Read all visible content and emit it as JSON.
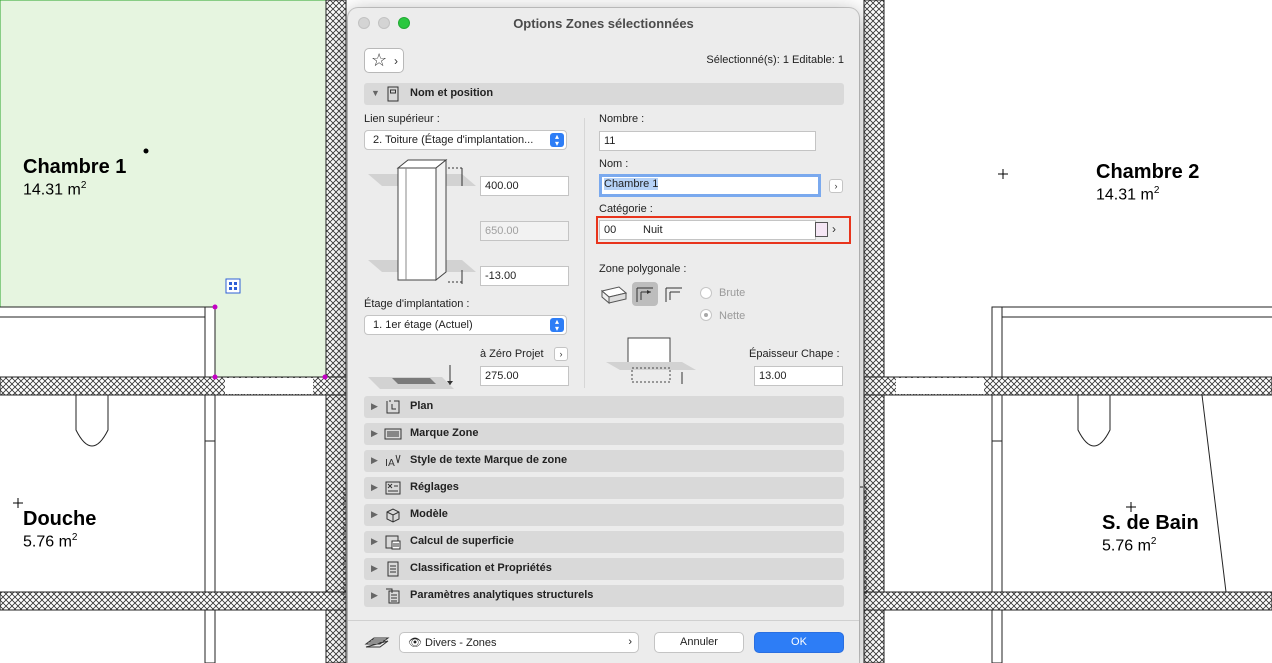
{
  "plan": {
    "rooms": [
      {
        "name": "Chambre 1",
        "area": "14.31 m",
        "unit_sup": "2"
      },
      {
        "name": "Chambre 2",
        "area": "14.31 m",
        "unit_sup": "2"
      },
      {
        "name": "Douche",
        "area": "5.76 m",
        "unit_sup": "2"
      },
      {
        "name": "S. de Bain",
        "area": "5.76 m",
        "unit_sup": "2"
      }
    ],
    "colors": {
      "selected_zone": "#e6f5e0",
      "selection_handle": "#c400c4"
    }
  },
  "dialog": {
    "title": "Options Zones sélectionnées",
    "selection_info": "Sélectionné(s): 1 Editable: 1",
    "favorites_icon": "star-icon",
    "main_section": {
      "label": "Nom et position",
      "top_link_label": "Lien supérieur :",
      "top_link_value": "2. Toiture (Étage d'implantation...",
      "top_offset": "400.00",
      "height": "650.00",
      "bottom_offset": "-13.00",
      "home_story_label": "Étage d'implantation :",
      "home_story_value": "1. 1er étage (Actuel)",
      "zero_ref_label": "à Zéro Projet",
      "zero_ref_value": "275.00",
      "number_label": "Nombre :",
      "number_value": "11",
      "name_label": "Nom :",
      "name_value": "Chambre 1",
      "category_label": "Catégorie :",
      "category_code": "00",
      "category_name": "Nuit",
      "category_color": "#f5e6f5",
      "polygon_label": "Zone polygonale :",
      "radio_gross": "Brute",
      "radio_net": "Nette",
      "screed_label": "Épaisseur Chape :",
      "screed_value": "13.00"
    },
    "sections": [
      {
        "label": "Plan",
        "icon": "plan-icon"
      },
      {
        "label": "Marque Zone",
        "icon": "zone-stamp-icon"
      },
      {
        "label": "Style de texte Marque de zone",
        "icon": "text-style-icon"
      },
      {
        "label": "Réglages",
        "icon": "settings-icon"
      },
      {
        "label": "Modèle",
        "icon": "model-icon"
      },
      {
        "label": "Calcul de superficie",
        "icon": "area-calc-icon"
      },
      {
        "label": "Classification et Propriétés",
        "icon": "classification-icon"
      },
      {
        "label": "Paramètres analytiques structurels",
        "icon": "structural-icon"
      }
    ],
    "footer": {
      "favorites_value": "Divers - Zones",
      "cancel_label": "Annuler",
      "ok_label": "OK"
    }
  }
}
